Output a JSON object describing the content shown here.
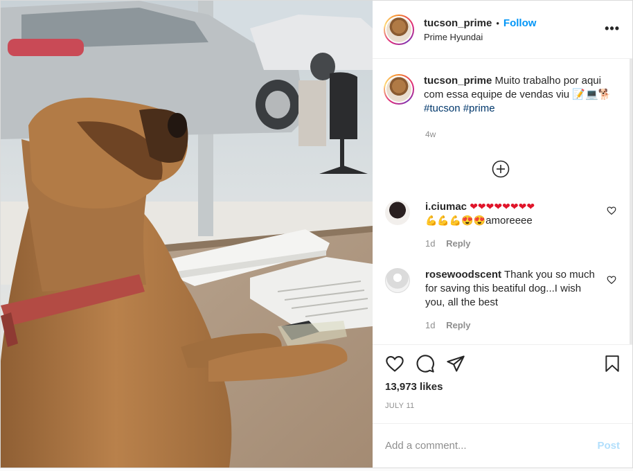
{
  "post": {
    "username": "tucson_prime",
    "follow_label": "Follow",
    "separator": "•",
    "location": "Prime Hyundai",
    "more_label": "•••"
  },
  "caption": {
    "username": "tucson_prime",
    "text": "Muito trabalho por aqui com essa equipe de vendas viu",
    "emojis": "📝💻🐕",
    "hashtags": [
      "#tucson",
      "#prime"
    ],
    "time_ago": "4w"
  },
  "comments": [
    {
      "username": "i.ciumac",
      "hearts": "❤❤❤❤❤❤❤❤",
      "emojis": "💪💪💪😍😍",
      "text": "amoreeee",
      "time_ago": "1d",
      "reply_label": "Reply"
    },
    {
      "username": "rosewoodscent",
      "text": "Thank you so much for saving this beatiful dog...I wish you, all the best",
      "time_ago": "1d",
      "reply_label": "Reply"
    }
  ],
  "engagement": {
    "likes": "13,973 likes",
    "date": "JULY 11"
  },
  "add_comment": {
    "placeholder": "Add a comment...",
    "post_label": "Post"
  },
  "icons": {
    "like": "heart-outline-icon",
    "comment": "speech-bubble-icon",
    "share": "paper-plane-icon",
    "save": "bookmark-icon",
    "load_more": "plus-circle-icon"
  },
  "colors": {
    "link_blue": "#0095f6",
    "hashtag": "#00376b",
    "muted": "#8e8e8e",
    "post_disabled": "#b2dffc"
  }
}
